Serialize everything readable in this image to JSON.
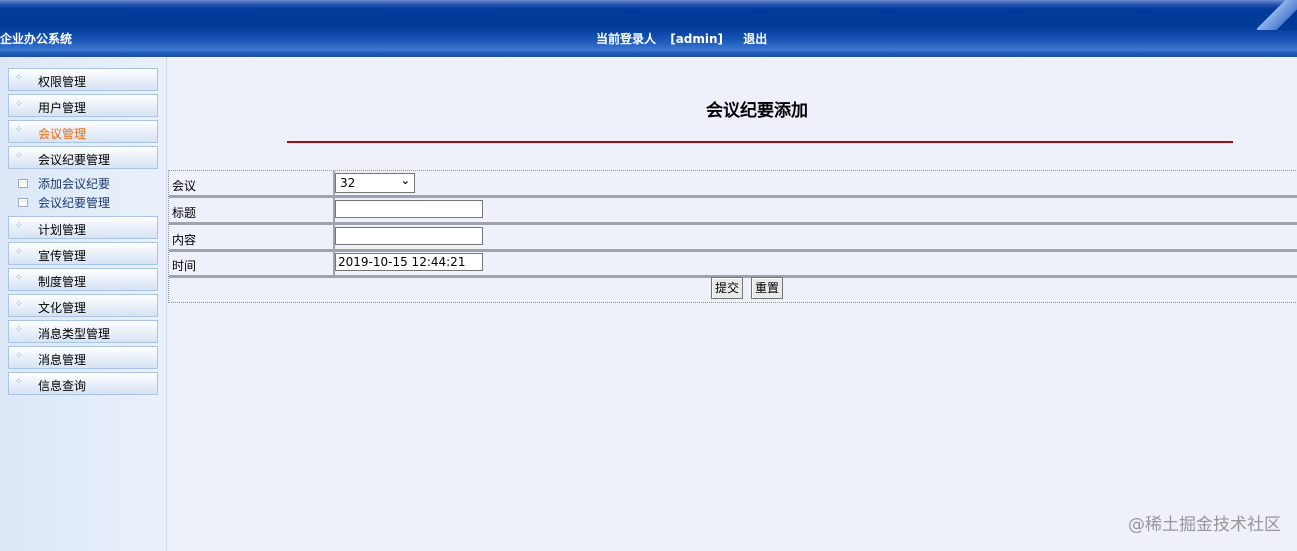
{
  "header": {
    "app_title": "企业办公系统",
    "current_user_label": "当前登录人",
    "username": "[admin]",
    "logout": "退出"
  },
  "sidebar": {
    "items": [
      {
        "label": "权限管理"
      },
      {
        "label": "用户管理"
      },
      {
        "label": "会议管理",
        "active": true
      },
      {
        "label": "会议纪要管理"
      },
      {
        "label": "计划管理"
      },
      {
        "label": "宣传管理"
      },
      {
        "label": "制度管理"
      },
      {
        "label": "文化管理"
      },
      {
        "label": "消息类型管理"
      },
      {
        "label": "消息管理"
      },
      {
        "label": "信息查询"
      }
    ],
    "sub_items": [
      {
        "label": "添加会议纪要"
      },
      {
        "label": "会议纪要管理"
      }
    ]
  },
  "main": {
    "title": "会议纪要添加",
    "form": {
      "meeting_label": "会议",
      "meeting_value": "32",
      "title_label": "标题",
      "title_value": "",
      "content_label": "内容",
      "content_value": "",
      "time_label": "时间",
      "time_value": "2019-10-15 12:44:21",
      "submit": "提交",
      "reset": "重置"
    }
  },
  "watermark": "@稀土掘金技术社区",
  "colors": {
    "header": "#003a98",
    "active": "#f26a10",
    "rule": "#a01010"
  }
}
